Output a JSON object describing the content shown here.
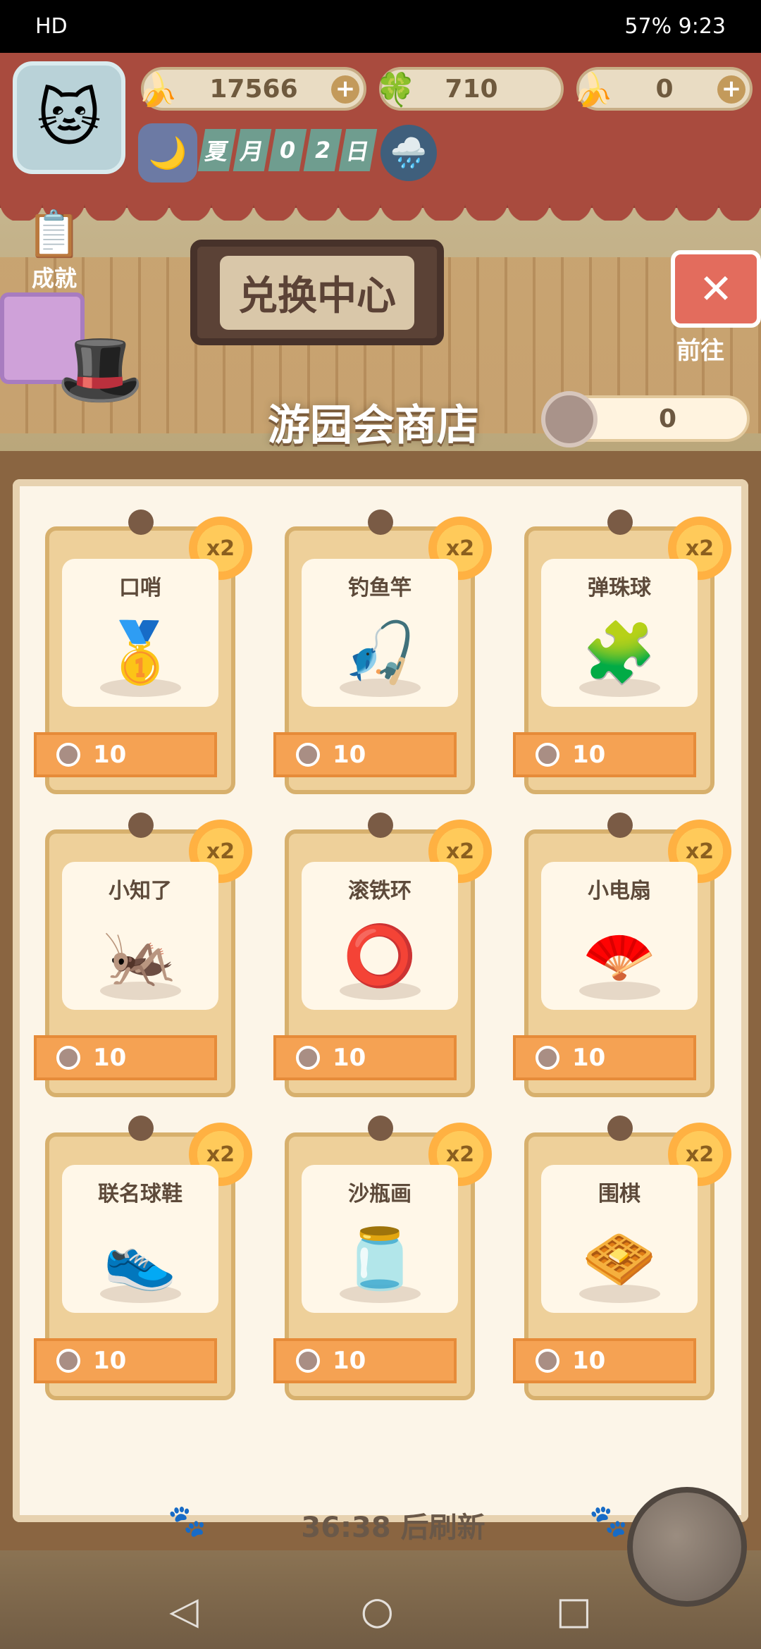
{
  "status": {
    "left_text": "HD",
    "battery": "57%",
    "time": "9:23"
  },
  "resources": [
    {
      "icon": "banana-icon",
      "value": "17566",
      "plus": "+"
    },
    {
      "icon": "clover-icon",
      "value": "710",
      "plus": ""
    },
    {
      "icon": "blue-banana-icon",
      "value": "0",
      "plus": "+"
    }
  ],
  "date": [
    "夏",
    "月",
    "0",
    "2",
    "日"
  ],
  "achievement_label": "成就",
  "exchange_center": "兑换中心",
  "goto_label": "前往",
  "shop_title": "游园会商店",
  "shop_token": "0",
  "items": [
    {
      "name": "口哨",
      "badge": "x2",
      "price": "10",
      "icon": "whistle-icon",
      "glyph": "🥇"
    },
    {
      "name": "钓鱼竿",
      "badge": "x2",
      "price": "10",
      "icon": "fishing-rod-icon",
      "glyph": "🎣"
    },
    {
      "name": "弹珠球",
      "badge": "x2",
      "price": "10",
      "icon": "marble-box-icon",
      "glyph": "🧩"
    },
    {
      "name": "小知了",
      "badge": "x2",
      "price": "10",
      "icon": "cicada-icon",
      "glyph": "🦗"
    },
    {
      "name": "滚铁环",
      "badge": "x2",
      "price": "10",
      "icon": "hoop-icon",
      "glyph": "⭕"
    },
    {
      "name": "小电扇",
      "badge": "x2",
      "price": "10",
      "icon": "fan-icon",
      "glyph": "🪭"
    },
    {
      "name": "联名球鞋",
      "badge": "x2",
      "price": "10",
      "icon": "sneaker-icon",
      "glyph": "👟"
    },
    {
      "name": "沙瓶画",
      "badge": "x2",
      "price": "10",
      "icon": "sand-bottle-icon",
      "glyph": "🫙"
    },
    {
      "name": "围棋",
      "badge": "x2",
      "price": "10",
      "icon": "go-board-icon",
      "glyph": "🧇"
    }
  ],
  "refresh_text": "36:38 后刷新"
}
